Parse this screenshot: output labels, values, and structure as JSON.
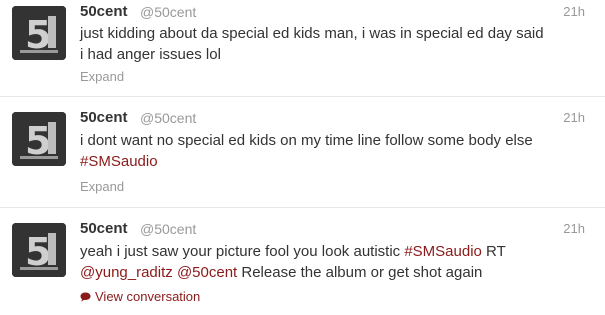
{
  "tweets": [
    {
      "name": "50cent",
      "handle": "@50cent",
      "time": "21h",
      "lines": [
        [
          {
            "t": "just kidding about da special ed kids man, i was in special ed day said"
          }
        ],
        [
          {
            "t": "i had anger issues lol"
          }
        ]
      ],
      "action": "Expand"
    },
    {
      "name": "50cent",
      "handle": "@50cent",
      "time": "21h",
      "lines": [
        [
          {
            "t": "i dont want no special ed kids on my time line follow some body else"
          }
        ],
        [
          {
            "t": "#SMSaudio",
            "k": "hashtag"
          }
        ]
      ],
      "action": "Expand"
    },
    {
      "name": "50cent",
      "handle": "@50cent",
      "time": "21h",
      "lines": [
        [
          {
            "t": "yeah i just saw your picture fool you look autistic "
          },
          {
            "t": "#SMSaudio",
            "k": "hashtag"
          },
          {
            "t": " RT"
          }
        ],
        [
          {
            "t": "@yung_raditz",
            "k": "mention"
          },
          {
            "t": " "
          },
          {
            "t": "@50cent",
            "k": "mention"
          },
          {
            "t": " Release the album or get shot again"
          }
        ]
      ],
      "action": "View conversation"
    }
  ],
  "colors": {
    "link": "#8b1a1a",
    "muted": "#999999",
    "text": "#333333",
    "divider": "#e8e8e8"
  },
  "icons": {
    "avatar": "profile-photo",
    "view_conversation": "speech-bubble-icon"
  }
}
